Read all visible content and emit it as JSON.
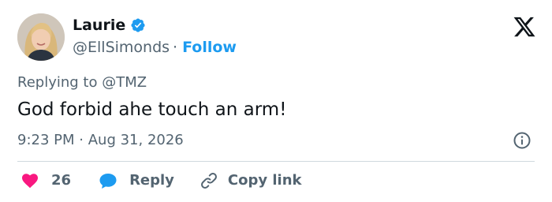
{
  "user": {
    "display_name": "Laurie",
    "handle": "@EllSimonds",
    "separator": "·",
    "follow_label": "Follow",
    "verified_icon": "verified-badge-icon",
    "avatar_icon": "avatar-photo"
  },
  "header": {
    "logo_icon": "x-logo-icon"
  },
  "tweet": {
    "replying_prefix": "Replying to",
    "replying_to": "@TMZ",
    "text": "God forbid ahe touch an arm!",
    "time": "9:23 PM",
    "date_separator": "·",
    "date": "Aug 31, 2026",
    "info_icon": "info-icon"
  },
  "actions": {
    "like_count": "26",
    "reply_label": "Reply",
    "copy_label": "Copy link",
    "like_icon": "heart-icon",
    "reply_icon": "speech-bubble-icon",
    "copy_icon": "link-icon"
  },
  "colors": {
    "accent": "#1d9bf0",
    "like": "#f91880",
    "text": "#0f1419",
    "muted": "#536471",
    "divider": "#cfd9de"
  }
}
